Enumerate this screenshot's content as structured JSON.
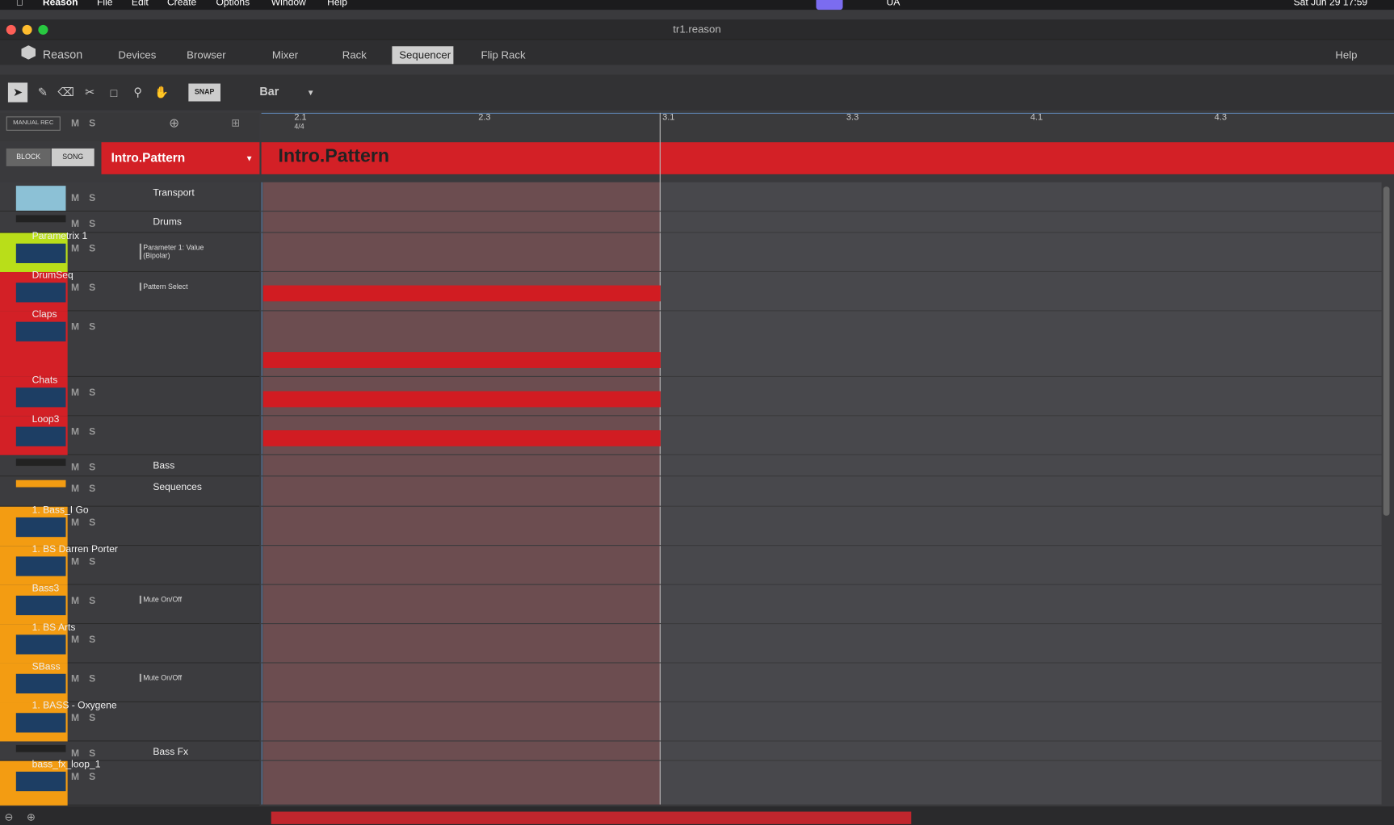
{
  "menubar": {
    "app": "Reason",
    "items": [
      "File",
      "Edit",
      "Create",
      "Options",
      "Window",
      "Help"
    ],
    "status": [
      "UA",
      "Sat Jun 29  17:59"
    ]
  },
  "window": {
    "title": "tr1.reason"
  },
  "nav": {
    "logo": "Reason",
    "items": [
      "Devices",
      "Browser",
      "Mixer",
      "Rack",
      "Sequencer",
      "Flip Rack"
    ],
    "active": "Sequencer",
    "help": "Help"
  },
  "toolbar": {
    "snap": "SNAP",
    "snap_value": "Bar",
    "tools": [
      "arrow-icon",
      "pencil-icon",
      "eraser-icon",
      "razor-icon",
      "mute-icon",
      "magnify-icon",
      "hand-icon"
    ]
  },
  "header": {
    "manual_rec": "MANUAL REC",
    "m": "M",
    "s": "S",
    "block": "BLOCK",
    "song": "SONG",
    "pattern_select": "Intro.Pattern"
  },
  "ruler": {
    "ticks": [
      "2.1",
      "2.3",
      "3.1",
      "3.3",
      "4.1",
      "4.3"
    ],
    "sig": "4/4"
  },
  "pattern_label": "Intro.Pattern",
  "tracks": [
    {
      "name": "Transport",
      "type": "folder",
      "color": "#8cc1d6"
    },
    {
      "name": "Drums",
      "type": "folder"
    },
    {
      "name": "Parametrix 1",
      "lane": "Parameter 1: Value (Bipolar)",
      "color": "#b9de19"
    },
    {
      "name": "DrumSeq",
      "lane": "Pattern Select",
      "color": "#d32026"
    },
    {
      "name": "Claps",
      "color": "#d32026"
    },
    {
      "name": "Chats",
      "color": "#d32026"
    },
    {
      "name": "Loop3",
      "color": "#d32026"
    },
    {
      "name": "Bass",
      "type": "folder"
    },
    {
      "name": "Sequences",
      "type": "folder",
      "color": "#f39c12"
    },
    {
      "name": "1. Bass_I Go",
      "color": "#f39c12"
    },
    {
      "name": "1. BS Darren Porter",
      "color": "#f39c12"
    },
    {
      "name": "Bass3",
      "lane": "Mute On/Off",
      "color": "#f39c12"
    },
    {
      "name": "1. BS Arts",
      "color": "#f39c12"
    },
    {
      "name": "SBass",
      "lane": "Mute On/Off",
      "color": "#f39c12"
    },
    {
      "name": "1. BASS - Oxygene",
      "color": "#f39c12"
    },
    {
      "name": "Bass Fx",
      "type": "folder"
    },
    {
      "name": "bass_fx_loop_1",
      "color": "#f39c12"
    }
  ]
}
